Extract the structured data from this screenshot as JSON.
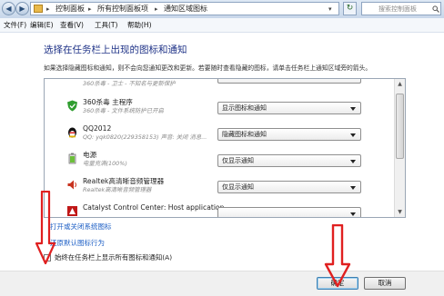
{
  "address_bar": {
    "crumbs": [
      "控制面板",
      "所有控制面板项",
      "通知区域图标"
    ],
    "search_placeholder": "搜索控制面板"
  },
  "menu": [
    "文件(F)",
    "编辑(E)",
    "查看(V)",
    "工具(T)",
    "帮助(H)"
  ],
  "heading": "选择在任务栏上出现的图标和通知",
  "description": "如果选择隐藏图标和通知，则不会向您通知更改和更新。若要随时查看隐藏的图标，请单击任务栏上通知区域旁的箭头。",
  "rows": [
    {
      "name": "",
      "sub": "360杀毒 - 卫士 - 不知名与更新保护",
      "option": "",
      "icon": "partial-icon"
    },
    {
      "name": "360杀毒 主程序",
      "sub": "360杀毒 - 文件系统防护已开启",
      "option": "显示图标和通知",
      "icon": "shield-icon"
    },
    {
      "name": "QQ2012",
      "sub": "QQ: yqk0820(229358153)  声音: 关闭  消息...",
      "option": "隐藏图标和通知",
      "icon": "qq-penguin-icon"
    },
    {
      "name": "电源",
      "sub": "电量充满(100%)",
      "option": "仅显示通知",
      "icon": "power-icon"
    },
    {
      "name": "Realtek高清晰音频管理器",
      "sub": "Realtek高清晰音频管理器",
      "option": "仅显示通知",
      "icon": "speaker-icon"
    },
    {
      "name": "Catalyst Control Center: Host application",
      "sub": "",
      "option": "",
      "icon": "ati-icon"
    }
  ],
  "links": {
    "toggle_system_icons": "打开或关闭系统图标",
    "restore_defaults": "还原默认图标行为"
  },
  "checkbox_label": "始终在任务栏上显示所有图标和通知(A)",
  "checkbox_checked": false,
  "buttons": {
    "ok": "确定",
    "cancel": "取消"
  },
  "colors": {
    "heading": "#1e3287",
    "link": "#1d5fc5",
    "annotation_arrow": "#e02020"
  }
}
